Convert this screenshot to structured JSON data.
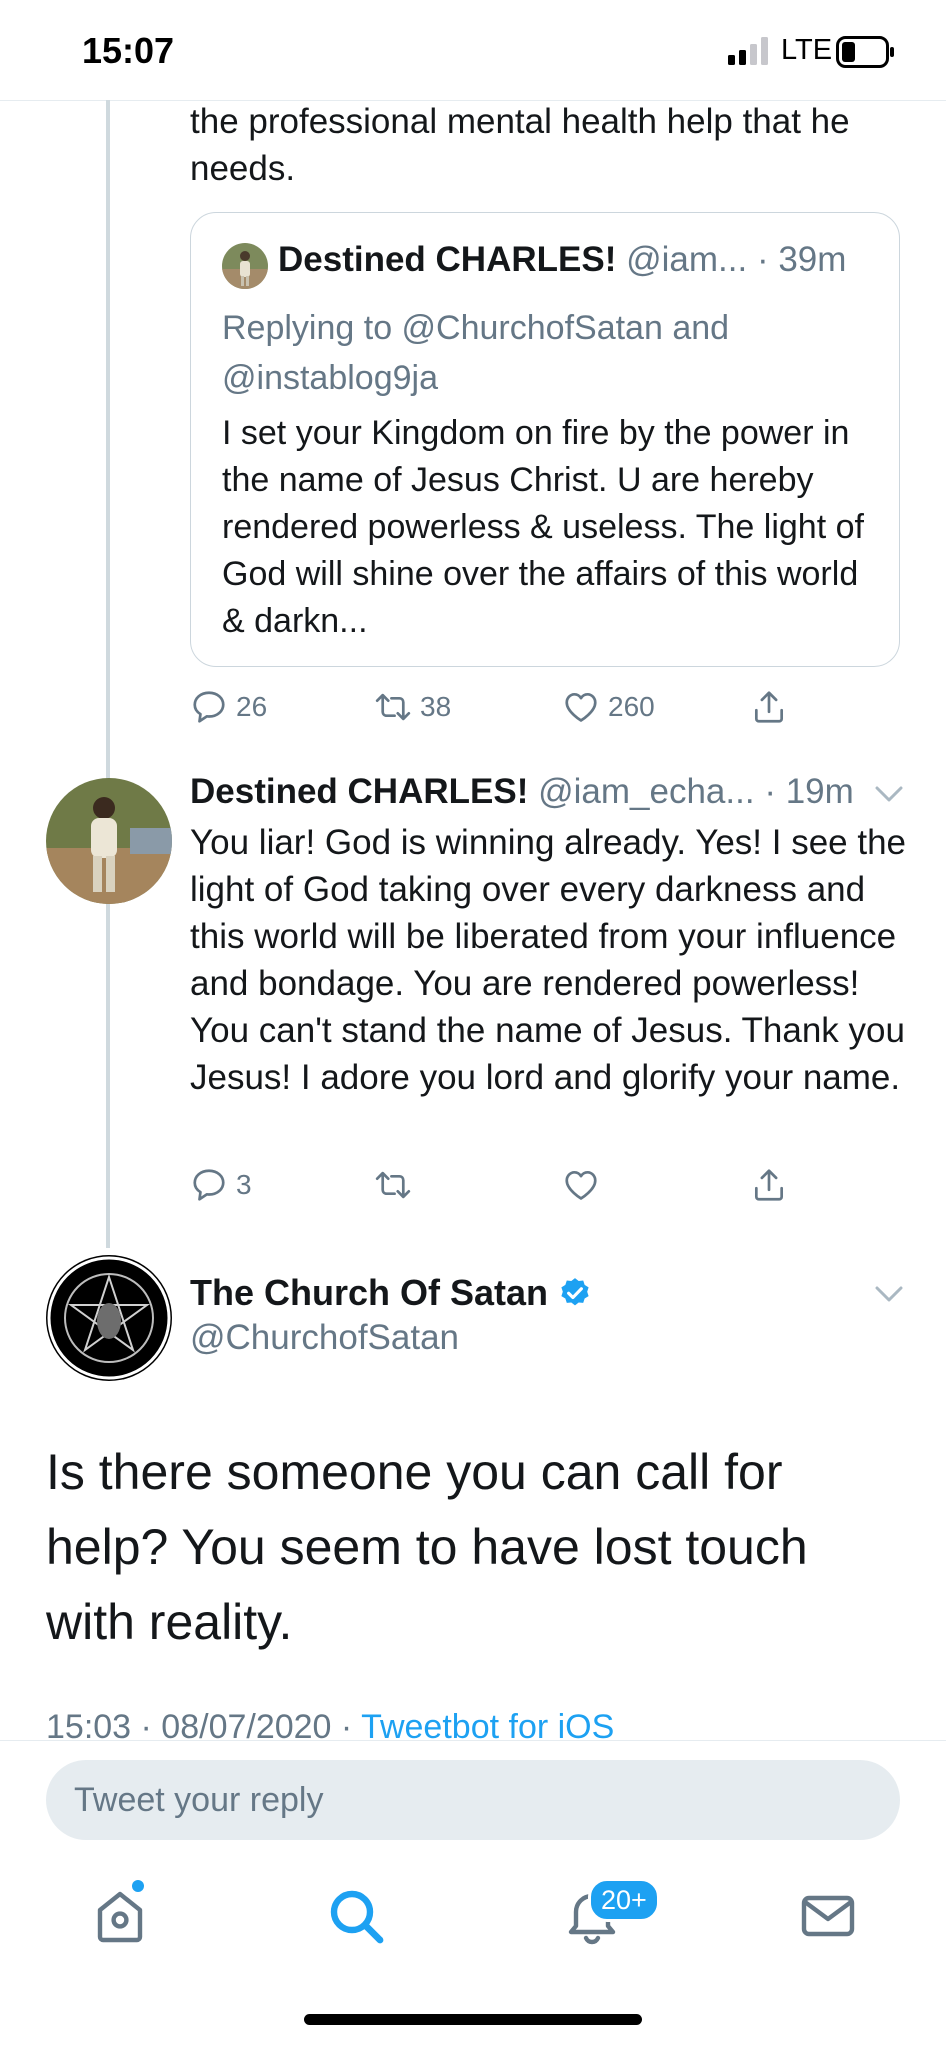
{
  "status_bar": {
    "time": "15:07",
    "carrier": "LTE"
  },
  "prev_tweet": {
    "text_tail": "the professional mental health help that he needs."
  },
  "quoted_tweet": {
    "name": "Destined CHARLES!",
    "handle": "@iam...",
    "time": "· 39m",
    "replying_to": "Replying to @ChurchofSatan and @instablog9ja",
    "text": "I set your Kingdom on fire by the power in the name of Jesus Christ. U are hereby rendered powerless & useless. The light of God will shine over the affairs of this world & darkn..."
  },
  "prev_actions": {
    "replies": "26",
    "retweets": "38",
    "likes": "260"
  },
  "reply_tweet": {
    "name": "Destined CHARLES!",
    "handle": "@iam_echa...",
    "time": "· 19m",
    "text": "You liar! God is winning already. Yes! I see the light of God taking over every darkness and this world will be liberated from your influence and bondage. You are rendered powerless! You can't stand the name of Jesus. Thank you Jesus! I adore you lord and glorify your name.",
    "replies": "3"
  },
  "main_tweet": {
    "name": "The Church Of Satan",
    "handle": "@ChurchofSatan",
    "text": "Is there someone you can call for help? You seem to have lost touch with reality.",
    "timestamp": "15:03 · 08/07/2020 ·",
    "source": "Tweetbot for iOS"
  },
  "reply_box": {
    "placeholder": "Tweet your reply"
  },
  "tab_bar": {
    "notifications_badge": "20+"
  },
  "colors": {
    "accent": "#1da1f2",
    "text": "#14171a",
    "meta": "#657786",
    "border": "#ccd6dd"
  },
  "icons": [
    "signal-icon",
    "battery-icon",
    "reply-icon",
    "retweet-icon",
    "like-icon",
    "share-icon",
    "chevron-down-icon",
    "verified-icon",
    "home-icon",
    "search-icon",
    "notifications-icon",
    "messages-icon"
  ]
}
